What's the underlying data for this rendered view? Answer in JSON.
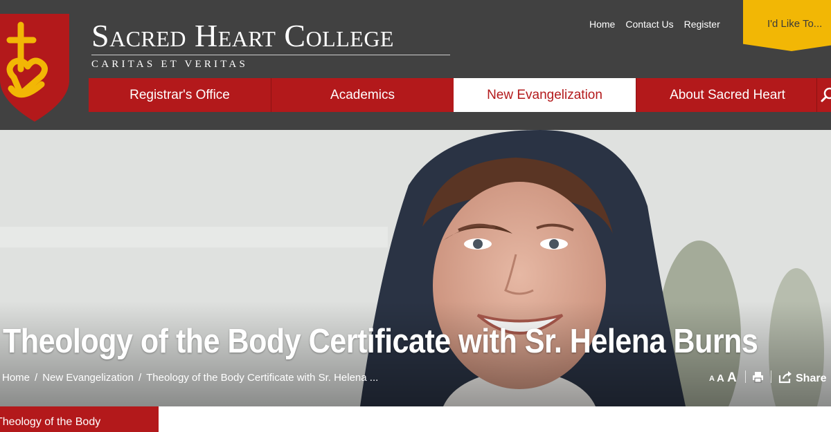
{
  "brand": {
    "name": "Sacred Heart College",
    "motto": "CARITAS ET VERITAS"
  },
  "utility_nav": [
    "Home",
    "Contact Us",
    "Register"
  ],
  "like_button": "I'd Like To...",
  "main_nav": [
    {
      "label": "Registrar's Office",
      "active": false
    },
    {
      "label": "Academics",
      "active": false
    },
    {
      "label": "New Evangelization",
      "active": true
    },
    {
      "label": "About Sacred Heart",
      "active": false
    }
  ],
  "hero": {
    "title": "Theology of the Body Certificate with Sr. Helena Burns",
    "breadcrumb": [
      "Home",
      "New Evangelization",
      "Theology of the Body Certificate with Sr. Helena ..."
    ],
    "font_sizes": [
      "A",
      "A",
      "A"
    ],
    "share_label": "Share"
  },
  "section_tab": "Theology of the Body",
  "colors": {
    "header_bg": "#414141",
    "brand_red": "#b3191b",
    "accent_yellow": "#f2b705"
  },
  "icons": [
    "crest-logo",
    "search-icon",
    "print-icon",
    "share-icon"
  ]
}
